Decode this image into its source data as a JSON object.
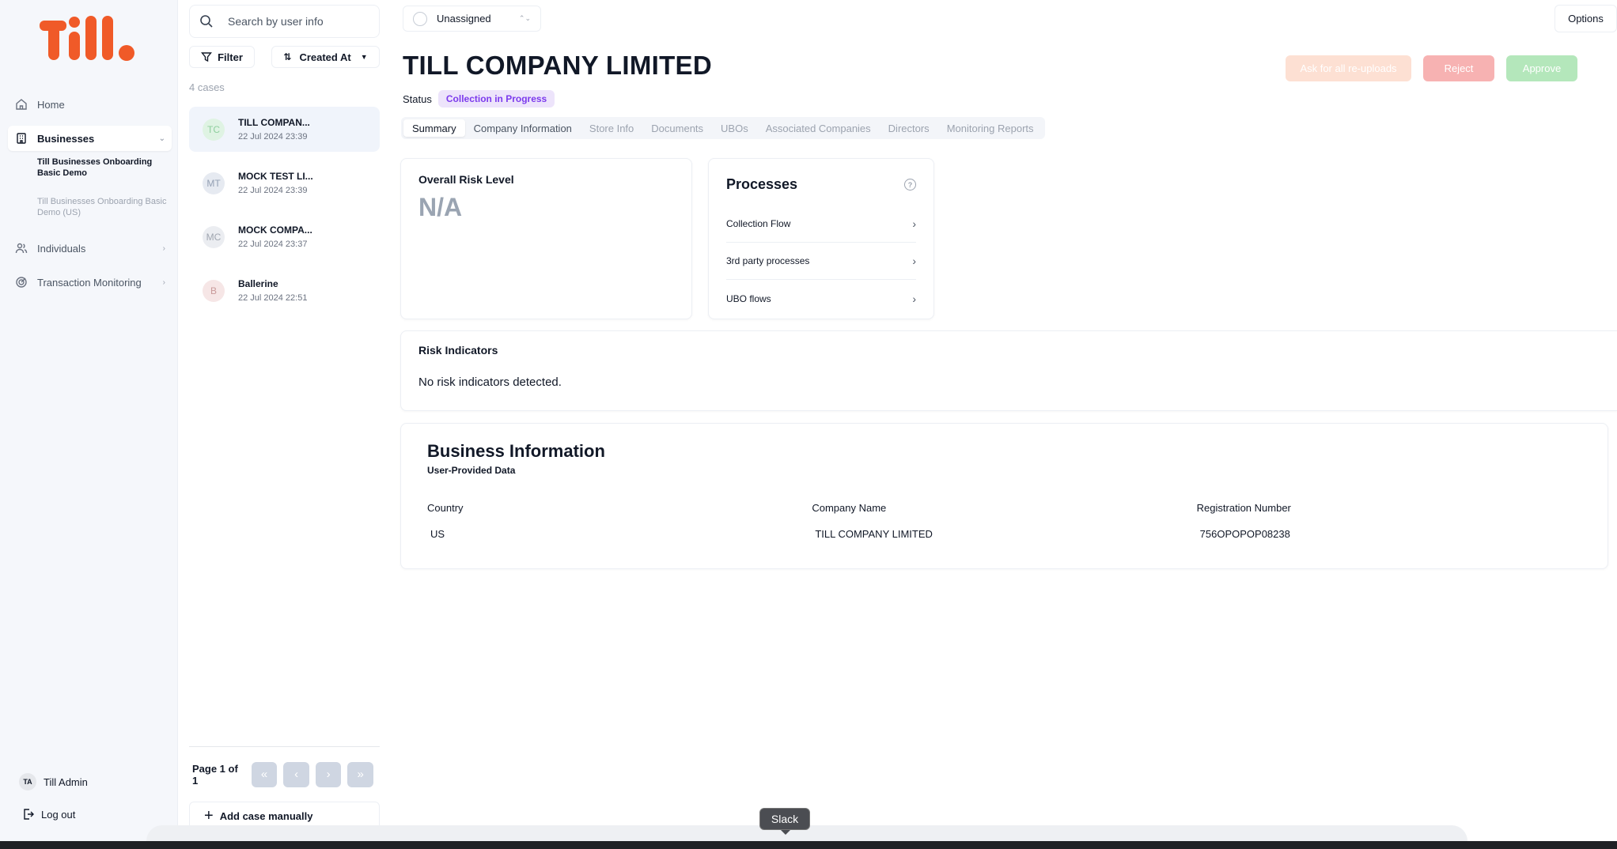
{
  "brand": {
    "logo_text": "Till.",
    "accent": "#f05a28"
  },
  "sidebar": {
    "items": [
      {
        "label": "Home",
        "icon": "home-icon"
      },
      {
        "label": "Businesses",
        "icon": "building-icon"
      },
      {
        "label": "Individuals",
        "icon": "users-icon"
      },
      {
        "label": "Transaction Monitoring",
        "icon": "monitoring-icon"
      }
    ],
    "sub_items": [
      {
        "label": "Till Businesses Onboarding Basic Demo"
      },
      {
        "label": "Till Businesses Onboarding Basic Demo (US)"
      }
    ],
    "user": {
      "initials": "TA",
      "name": "Till Admin"
    },
    "logout_label": "Log out"
  },
  "case_list": {
    "search_placeholder": "Search by user info",
    "filter_label": "Filter",
    "sort_label": "Created At",
    "count_label": "4 cases",
    "cases": [
      {
        "initials": "TC",
        "name": "TILL COMPAN...",
        "date": "22 Jul 2024 23:39"
      },
      {
        "initials": "MT",
        "name": "MOCK TEST LI...",
        "date": "22 Jul 2024 23:39"
      },
      {
        "initials": "MC",
        "name": "MOCK COMPA...",
        "date": "22 Jul 2024 23:37"
      },
      {
        "initials": "B",
        "name": "Ballerine",
        "date": "22 Jul 2024 22:51"
      }
    ],
    "page_label": "Page 1 of 1",
    "add_case_label": "Add case manually"
  },
  "main": {
    "assignee": "Unassigned",
    "options_label": "Options",
    "company_title": "TILL COMPANY LIMITED",
    "status_label": "Status",
    "status_value": "Collection in Progress",
    "actions": {
      "reupload": "Ask for all re-uploads",
      "reject": "Reject",
      "approve": "Approve"
    },
    "tabs": [
      "Summary",
      "Company Information",
      "Store Info",
      "Documents",
      "UBOs",
      "Associated Companies",
      "Directors",
      "Monitoring Reports"
    ],
    "risk_level": {
      "title": "Overall Risk Level",
      "value": "N/A"
    },
    "processes": {
      "title": "Processes",
      "items": [
        "Collection Flow",
        "3rd party processes",
        "UBO flows"
      ]
    },
    "risk_indicators": {
      "title": "Risk Indicators",
      "text": "No risk indicators detected."
    },
    "business_info": {
      "title": "Business Information",
      "subtitle": "User-Provided Data",
      "fields": [
        {
          "label": "Country",
          "value": "US"
        },
        {
          "label": "Company Name",
          "value": "TILL COMPANY LIMITED"
        },
        {
          "label": "Registration Number",
          "value": "756OPOPOP08238"
        }
      ]
    }
  },
  "overlay": {
    "tooltip": "Slack"
  }
}
